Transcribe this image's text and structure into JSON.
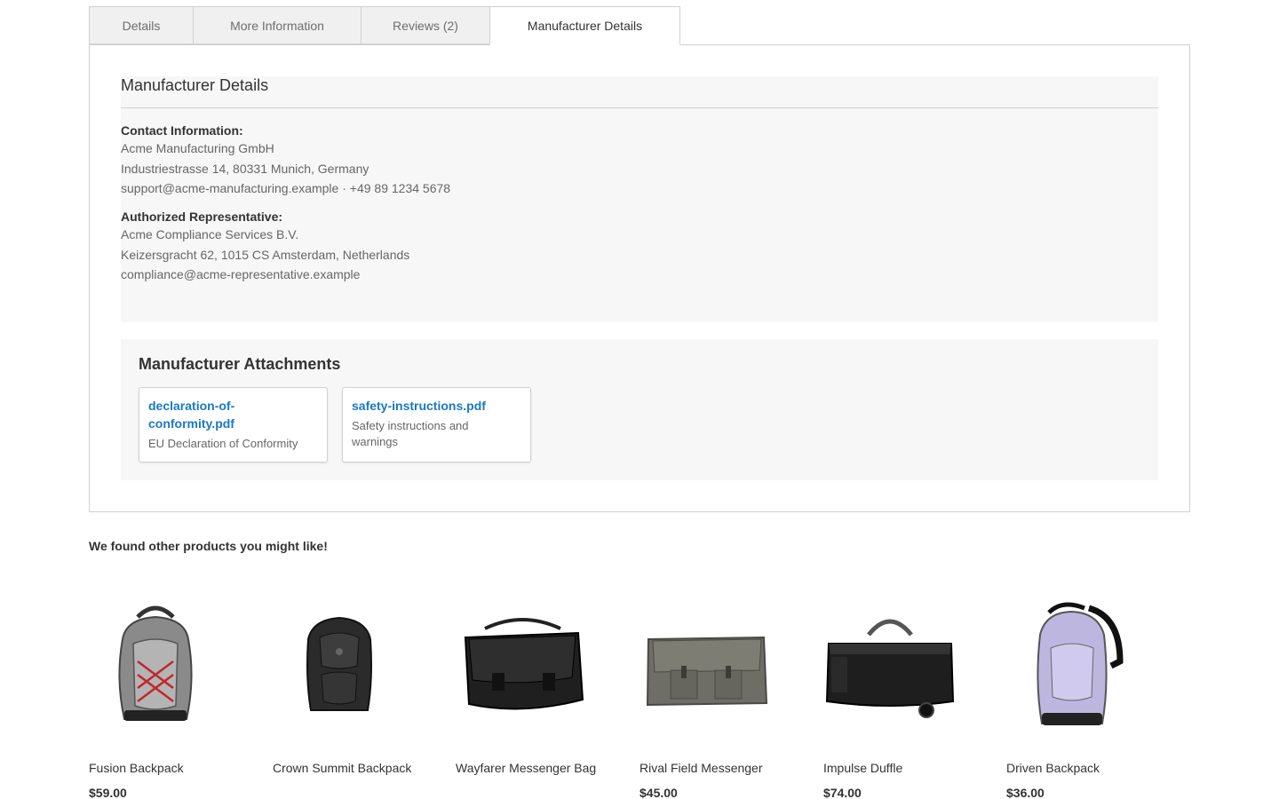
{
  "tabs": [
    {
      "label": "Details"
    },
    {
      "label": "More Information"
    },
    {
      "label": "Reviews (2)"
    },
    {
      "label": "Manufacturer Details"
    }
  ],
  "manufacturer": {
    "title": "Manufacturer Details",
    "contact_label": "Contact Information:",
    "contact_lines": [
      "Acme Manufacturing GmbH",
      "Industriestrasse 14, 80331 Munich, Germany",
      "support@acme-manufacturing.example · +49 89 1234 5678"
    ],
    "rep_label": "Authorized Representative:",
    "rep_lines": [
      "Acme Compliance Services B.V.",
      "Keizersgracht 62, 1015 CS Amsterdam, Netherlands",
      "compliance@acme-representative.example"
    ]
  },
  "attachments": {
    "title": "Manufacturer Attachments",
    "items": [
      {
        "file": "declaration-of-conformity.pdf",
        "file_display": "declaration-of-\nconformity.pdf",
        "description": "EU Declaration of Conformity"
      },
      {
        "file": "safety-instructions.pdf",
        "file_display": "safety-instructions.pdf",
        "description": "Safety instructions and warnings"
      }
    ]
  },
  "related": {
    "title": "We found other products you might like!",
    "products": [
      {
        "name": "Fusion Backpack",
        "price": "$59.00",
        "icon": "backpack-gray-red"
      },
      {
        "name": "Crown Summit Backpack",
        "price": "",
        "icon": "backpack-black"
      },
      {
        "name": "Wayfarer Messenger Bag",
        "price": "",
        "icon": "messenger-black"
      },
      {
        "name": "Rival Field Messenger",
        "price": "$45.00",
        "icon": "messenger-gray"
      },
      {
        "name": "Impulse Duffle",
        "price": "$74.00",
        "icon": "duffle-black"
      },
      {
        "name": "Driven Backpack",
        "price": "$36.00",
        "icon": "backpack-lavender"
      }
    ]
  },
  "colors": {
    "link": "#1979c3",
    "border": "#d1d1d1",
    "panel_bg": "#f7f7f7"
  }
}
